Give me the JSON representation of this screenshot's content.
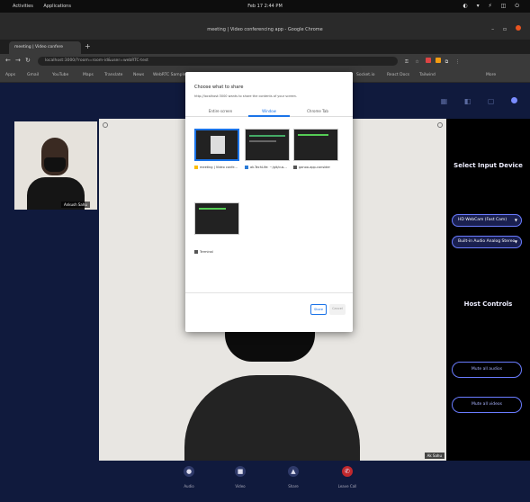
{
  "os": {
    "activities": "Activities",
    "app_menu": "Applications",
    "clock": "Feb 17  2:44 PM"
  },
  "window": {
    "title": "meeting | Video conferencing app - Google Chrome"
  },
  "browser": {
    "tab_title": "meeting | Video confere",
    "url": "localhost:3000/?room=room-id&user=webRTC-test",
    "bookmarks": [
      "Apps",
      "Gmail",
      "YouTube",
      "Maps",
      "Translate",
      "News",
      "WebRTC Samples",
      "Socket.io",
      "React Docs",
      "Tailwind",
      "More"
    ]
  },
  "app": {
    "local_name": "Ankush Sahu",
    "remote_name": "Ak Sahu",
    "right_panel": {
      "title": "Select Input Device",
      "video_device": "HD WebCam (Fast Cam)",
      "audio_device": "Built-in Audio Analog Stereo",
      "host_title": "Host Controls",
      "mute_audio": "Mute all audios",
      "mute_video": "Mute all videos"
    },
    "controls": [
      {
        "label": "Audio",
        "icon": "mic-icon"
      },
      {
        "label": "Video",
        "icon": "camera-icon"
      },
      {
        "label": "Share",
        "icon": "screen-share-icon"
      },
      {
        "label": "Leave Call",
        "icon": "phone-hangup-icon"
      }
    ]
  },
  "dialog": {
    "title": "Choose what to share",
    "subtitle": "http://localhost:3000 wants to share the contents of your screen.",
    "tabs": [
      "Entire screen",
      "Window",
      "Chrome Tab"
    ],
    "active_tab": "Window",
    "windows": [
      {
        "label": "meeting | Video confe...",
        "favicon": "chrome-icon"
      },
      {
        "label": "ak-TechLife: ~/git/cus...",
        "favicon": "vscode-icon"
      },
      {
        "label": "ganoo-app-consider",
        "favicon": "terminal-icon"
      },
      {
        "label": "Terminal",
        "favicon": "terminal-icon"
      }
    ],
    "share_label": "Share",
    "cancel_label": "Cancel"
  },
  "colors": {
    "app_bg": "#101a3d",
    "accent": "#6a7cff",
    "dialog_accent": "#1a73e8",
    "leave": "#c0282d"
  }
}
